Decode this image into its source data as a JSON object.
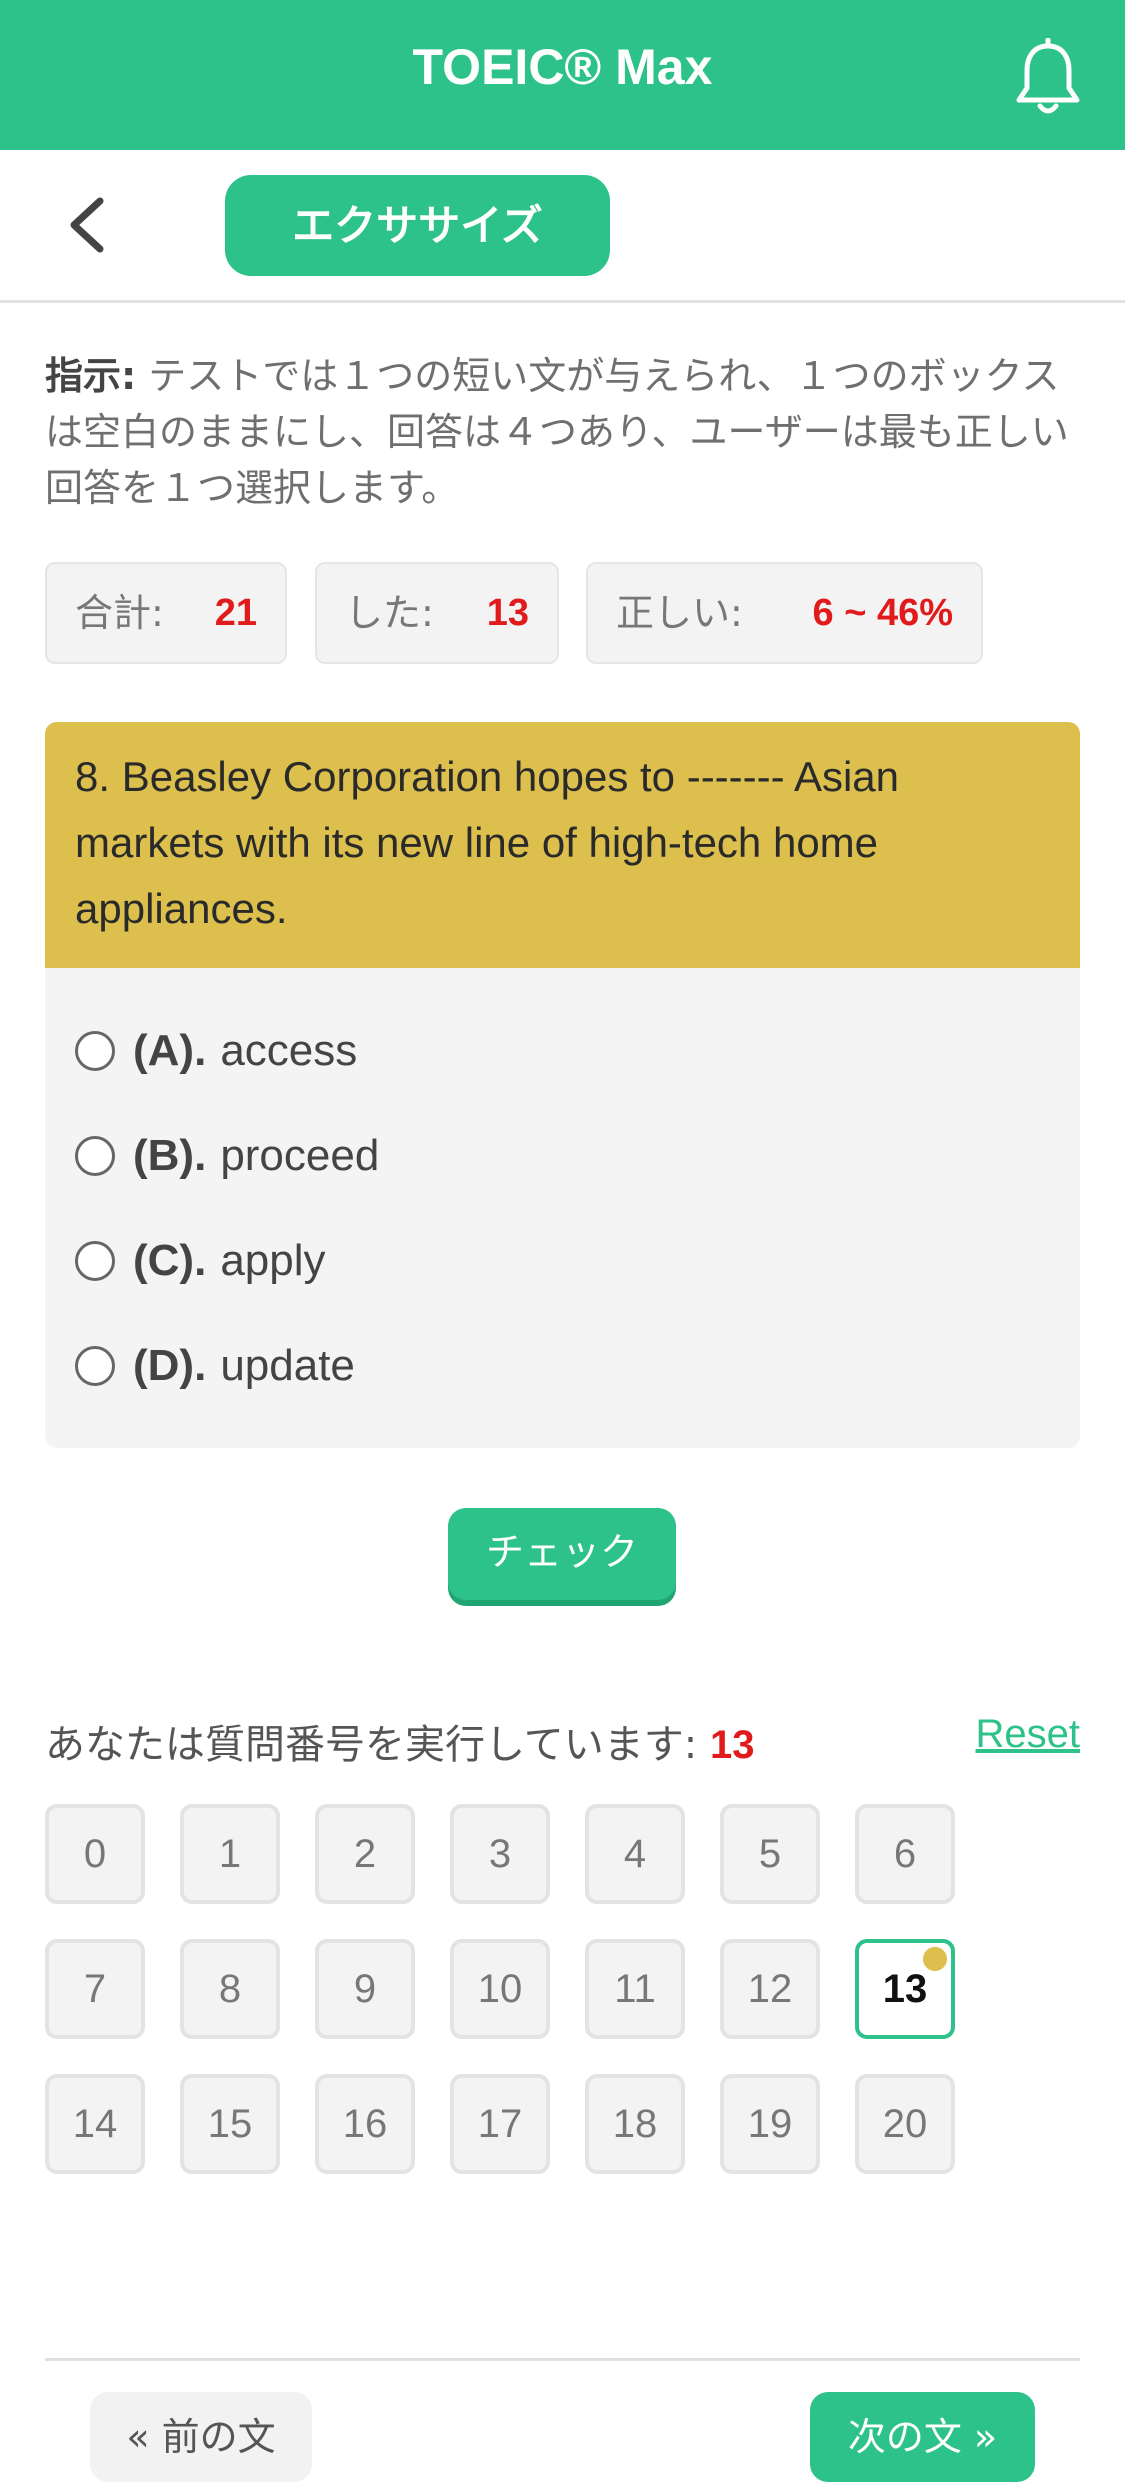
{
  "header": {
    "title": "TOEIC® Max",
    "bell_icon": "bell-icon"
  },
  "subbar": {
    "back_icon": "chevron-left-icon",
    "tab_label": "エクササイズ"
  },
  "instructions": {
    "label": "指示:",
    "text": " テストでは１つの短い文が与えられ、１つのボックスは空白のままにし、回答は４つあり、ユーザーは最も正しい回答を１つ選択します。"
  },
  "stats": {
    "total_label": "合計:",
    "total_value": "21",
    "done_label": "した:",
    "done_value": "13",
    "correct_label": "正しい:",
    "correct_value": "6 ~ 46%"
  },
  "question": {
    "text": "8. Beasley Corporation hopes to ------- Asian markets with its new line of high-tech home appliances.",
    "options": [
      {
        "key": "(A).",
        "text": "access"
      },
      {
        "key": "(B).",
        "text": "proceed"
      },
      {
        "key": "(C).",
        "text": "apply"
      },
      {
        "key": "(D).",
        "text": "update"
      }
    ]
  },
  "check_button": "チェック",
  "progress": {
    "label": "あなたは質問番号を実行しています:",
    "current": "13",
    "reset": "Reset"
  },
  "numbers": [
    "0",
    "1",
    "2",
    "3",
    "4",
    "5",
    "6",
    "7",
    "8",
    "9",
    "10",
    "11",
    "12",
    "13",
    "14",
    "15",
    "16",
    "17",
    "18",
    "19",
    "20"
  ],
  "nav": {
    "prev": "« 前の文",
    "next": "次の文 »"
  },
  "colors": {
    "accent": "#2cc289",
    "question_bg": "#dcbf4c",
    "highlight": "#e11b1b"
  }
}
